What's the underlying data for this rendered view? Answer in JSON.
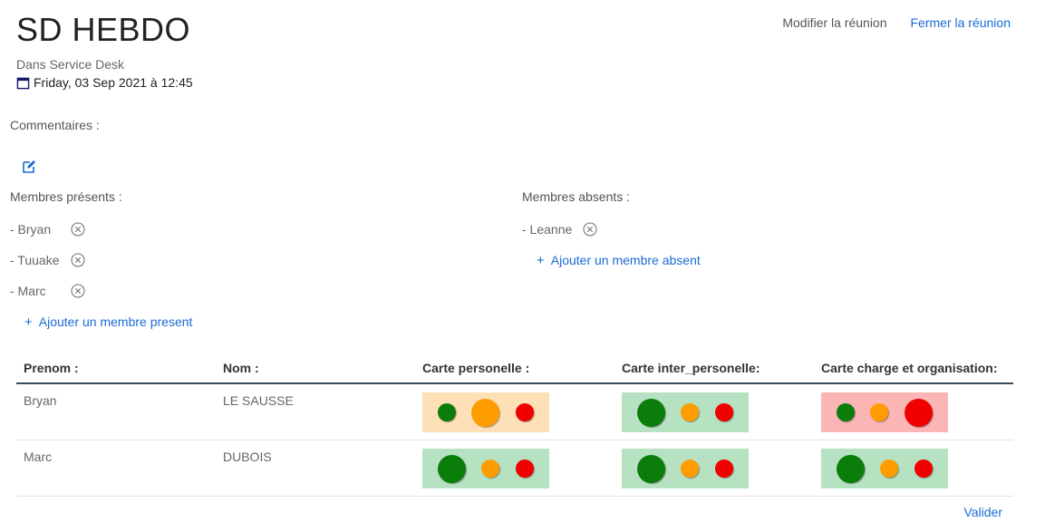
{
  "header": {
    "title": "SD HEBDO",
    "modify_label": "Modifier la réunion",
    "close_label": "Fermer la réunion",
    "service": "Dans Service Desk",
    "date": "Friday, 03 Sep 2021 à 12:45"
  },
  "comments": {
    "label": "Commentaires :"
  },
  "present": {
    "title": "Membres présents :",
    "members": [
      "- Bryan",
      "- Tuuake",
      "- Marc"
    ],
    "add_label": "Ajouter un membre present"
  },
  "absent": {
    "title": "Membres absents :",
    "members": [
      "- Leanne"
    ],
    "add_label": "Ajouter un membre absent"
  },
  "table": {
    "headers": [
      "Prenom :",
      "Nom :",
      "Carte personelle :",
      "Carte inter_personelle:",
      "Carte charge et organisation:"
    ],
    "rows": [
      {
        "prenom": "Bryan",
        "nom": "LE SAUSSE",
        "cards": [
          {
            "background": "#fde0b6",
            "active": "orange"
          },
          {
            "background": "#b7e2c2",
            "active": "green"
          },
          {
            "background": "#fbb5b5",
            "active": "red"
          }
        ]
      },
      {
        "prenom": "Marc",
        "nom": "DUBOIS",
        "cards": [
          {
            "background": "#b7e2c2",
            "active": "green"
          },
          {
            "background": "#b7e2c2",
            "active": "green"
          },
          {
            "background": "#b7e2c2",
            "active": "green"
          }
        ]
      }
    ]
  },
  "colors": {
    "green": "#0a7d0a",
    "orange": "#ff9d00",
    "red": "#f00000",
    "link": "#1a6bd6"
  },
  "footer": {
    "validate_label": "Valider"
  }
}
